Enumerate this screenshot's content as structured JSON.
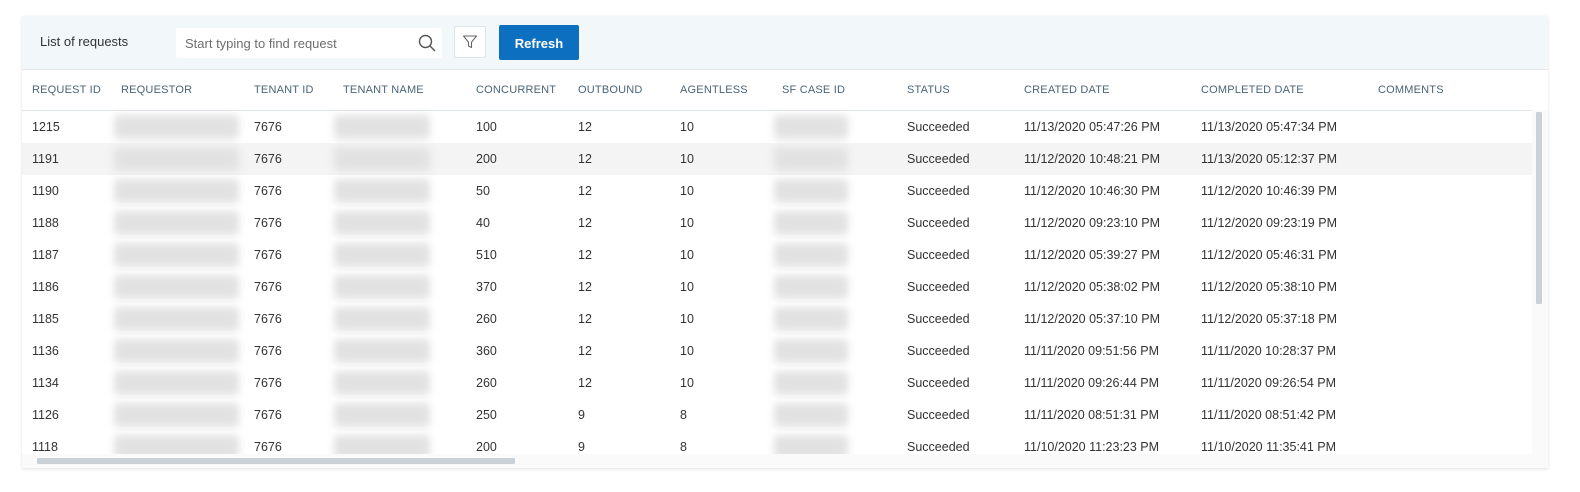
{
  "toolbar": {
    "title": "List of requests",
    "search_placeholder": "Start typing to find request",
    "refresh_label": "Refresh"
  },
  "columns": [
    "REQUEST ID",
    "REQUESTOR",
    "TENANT ID",
    "TENANT NAME",
    "CONCURRENT",
    "OUTBOUND",
    "AGENTLESS",
    "SF CASE ID",
    "STATUS",
    "CREATED DATE",
    "COMPLETED DATE",
    "COMMENTS"
  ],
  "rows": [
    {
      "request_id": "1215",
      "tenant_id": "7676",
      "concurrent": "100",
      "outbound": "12",
      "agentless": "10",
      "status": "Succeeded",
      "created": "11/13/2020 05:47:26 PM",
      "completed": "11/13/2020 05:47:34 PM",
      "comments": ""
    },
    {
      "request_id": "1191",
      "tenant_id": "7676",
      "concurrent": "200",
      "outbound": "12",
      "agentless": "10",
      "status": "Succeeded",
      "created": "11/12/2020 10:48:21 PM",
      "completed": "11/13/2020 05:12:37 PM",
      "comments": ""
    },
    {
      "request_id": "1190",
      "tenant_id": "7676",
      "concurrent": "50",
      "outbound": "12",
      "agentless": "10",
      "status": "Succeeded",
      "created": "11/12/2020 10:46:30 PM",
      "completed": "11/12/2020 10:46:39 PM",
      "comments": ""
    },
    {
      "request_id": "1188",
      "tenant_id": "7676",
      "concurrent": "40",
      "outbound": "12",
      "agentless": "10",
      "status": "Succeeded",
      "created": "11/12/2020 09:23:10 PM",
      "completed": "11/12/2020 09:23:19 PM",
      "comments": ""
    },
    {
      "request_id": "1187",
      "tenant_id": "7676",
      "concurrent": "510",
      "outbound": "12",
      "agentless": "10",
      "status": "Succeeded",
      "created": "11/12/2020 05:39:27 PM",
      "completed": "11/12/2020 05:46:31 PM",
      "comments": ""
    },
    {
      "request_id": "1186",
      "tenant_id": "7676",
      "concurrent": "370",
      "outbound": "12",
      "agentless": "10",
      "status": "Succeeded",
      "created": "11/12/2020 05:38:02 PM",
      "completed": "11/12/2020 05:38:10 PM",
      "comments": ""
    },
    {
      "request_id": "1185",
      "tenant_id": "7676",
      "concurrent": "260",
      "outbound": "12",
      "agentless": "10",
      "status": "Succeeded",
      "created": "11/12/2020 05:37:10 PM",
      "completed": "11/12/2020 05:37:18 PM",
      "comments": ""
    },
    {
      "request_id": "1136",
      "tenant_id": "7676",
      "concurrent": "360",
      "outbound": "12",
      "agentless": "10",
      "status": "Succeeded",
      "created": "11/11/2020 09:51:56 PM",
      "completed": "11/11/2020 10:28:37 PM",
      "comments": ""
    },
    {
      "request_id": "1134",
      "tenant_id": "7676",
      "concurrent": "260",
      "outbound": "12",
      "agentless": "10",
      "status": "Succeeded",
      "created": "11/11/2020 09:26:44 PM",
      "completed": "11/11/2020 09:26:54 PM",
      "comments": ""
    },
    {
      "request_id": "1126",
      "tenant_id": "7676",
      "concurrent": "250",
      "outbound": "9",
      "agentless": "8",
      "status": "Succeeded",
      "created": "11/11/2020 08:51:31 PM",
      "completed": "11/11/2020 08:51:42 PM",
      "comments": ""
    },
    {
      "request_id": "1118",
      "tenant_id": "7676",
      "concurrent": "200",
      "outbound": "9",
      "agentless": "8",
      "status": "Succeeded",
      "created": "11/10/2020 11:23:23 PM",
      "completed": "11/10/2020 11:35:41 PM",
      "comments": ""
    }
  ],
  "colors": {
    "accent": "#0d6fbf",
    "header_text": "#4a6578",
    "toolbar_bg": "#f2f7fa"
  },
  "icons": {
    "search": "search-icon",
    "filter": "filter-icon"
  }
}
